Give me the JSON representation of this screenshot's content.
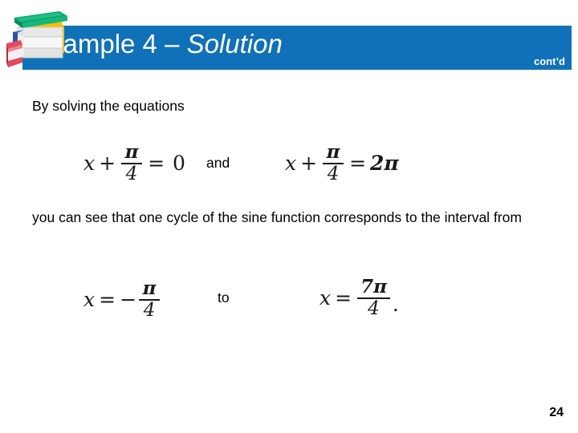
{
  "header": {
    "title_main": "Example 4 – ",
    "title_italic": "Solution",
    "contd_label": "cont’d",
    "banner_color": "#1071B8",
    "title_color": "#FFFFFF"
  },
  "icons": {
    "books": "books-stack-icon"
  },
  "body": {
    "intro_line": "By solving the equations",
    "connector_and": "and",
    "middle_paragraph": "you can see that one cycle of the sine function corresponds to the interval from",
    "connector_to": "to"
  },
  "equations": [
    {
      "id": "equation-1",
      "plain": "x + π/4 = 0",
      "var": "x",
      "op1": "+",
      "numerator": "π",
      "denominator": "4",
      "equals": "=",
      "result": "0",
      "negative": false,
      "trailing": ""
    },
    {
      "id": "equation-2",
      "plain": "x + π/4 = 2π",
      "var": "x",
      "op1": "+",
      "numerator": "π",
      "denominator": "4",
      "equals": "=",
      "result": "2π",
      "negative": false,
      "trailing": ""
    },
    {
      "id": "equation-3",
      "plain": "x = −π/4",
      "var": "x",
      "equals": "=",
      "sign": "−",
      "numerator": "π",
      "denominator": "4",
      "negative": true,
      "trailing": ""
    },
    {
      "id": "equation-4",
      "plain": "x = 7π/4.",
      "var": "x",
      "equals": "=",
      "numerator": "7π",
      "denominator": "4",
      "negative": false,
      "trailing": "."
    }
  ],
  "footer": {
    "page_number": "24"
  }
}
